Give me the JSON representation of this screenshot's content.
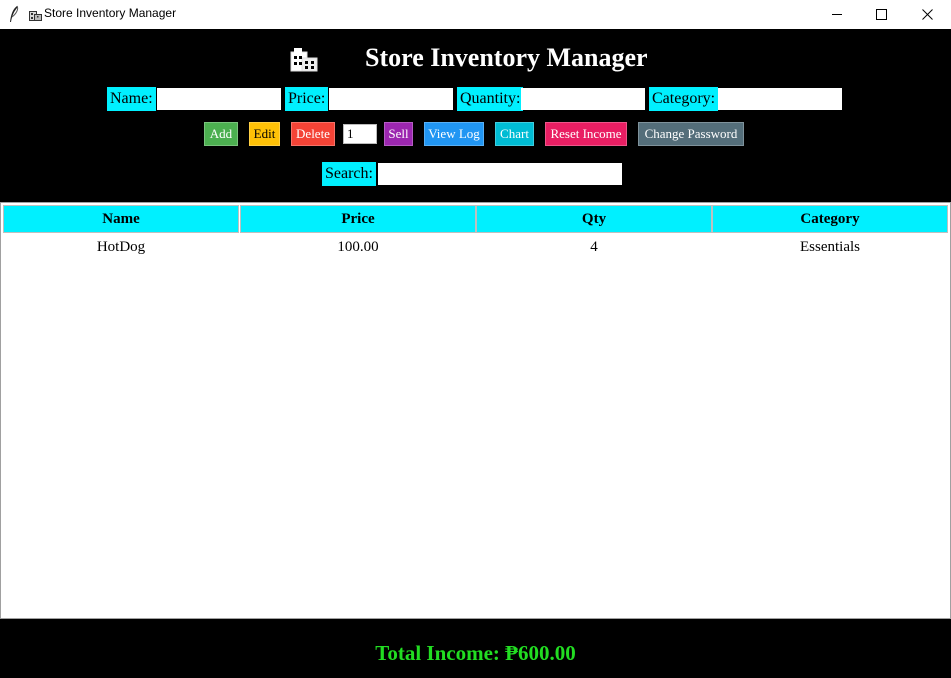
{
  "window": {
    "title": "Store Inventory Manager",
    "icon": "briefcase-icon"
  },
  "header": {
    "title": "Store Inventory Manager",
    "icon": "office-building-icon"
  },
  "form": {
    "name_label": "Name:",
    "price_label": "Price:",
    "quantity_label": "Quantity:",
    "category_label": "Category:",
    "name_value": "",
    "price_value": "",
    "quantity_value": "",
    "category_value": ""
  },
  "toolbar": {
    "add_label": "Add",
    "edit_label": "Edit",
    "delete_label": "Delete",
    "sell_qty": "1",
    "sell_label": "Sell",
    "view_log_label": "View Log",
    "chart_label": "Chart",
    "reset_income_label": "Reset Income",
    "change_password_label": "Change Password"
  },
  "search": {
    "label": "Search:",
    "value": ""
  },
  "table": {
    "columns": [
      "Name",
      "Price",
      "Qty",
      "Category"
    ],
    "rows": [
      [
        "HotDog",
        "100.00",
        "4",
        "Essentials"
      ]
    ]
  },
  "footer": {
    "total_income": "Total Income: ₱600.00"
  },
  "colors": {
    "background": "#000000",
    "label_bg": "#00f0ff",
    "add": "#4caf50",
    "edit": "#ffc107",
    "delete": "#f44336",
    "sell": "#9c27b0",
    "view_log": "#2196f3",
    "chart": "#00bcd4",
    "reset_income": "#e91e63",
    "change_password": "#546e7a",
    "income_text": "#22dd22"
  }
}
